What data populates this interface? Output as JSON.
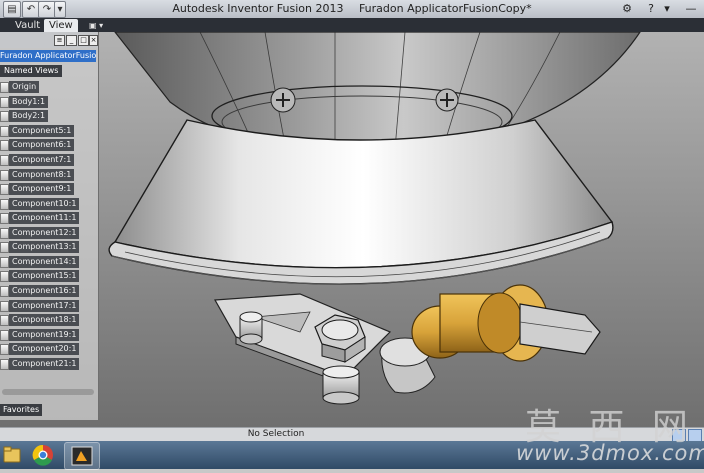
{
  "window": {
    "app_title": "Autodesk Inventor Fusion 2013",
    "document_title": "Furadon ApplicatorFusionCopy*"
  },
  "quick_access": {
    "undo_icon": "undo-icon",
    "redo_icon": "redo-icon",
    "dropdown_icon": "chevron-down-icon"
  },
  "tabs": [
    {
      "label": "Vault",
      "active": false
    },
    {
      "label": "View",
      "active": true
    }
  ],
  "browser": {
    "document_node": "Furadon ApplicatorFusionCopy*",
    "named_views": "Named Views",
    "items": [
      "Origin",
      "Body1:1",
      "Body2:1",
      "Component5:1",
      "Component6:1",
      "Component7:1",
      "Component8:1",
      "Component9:1",
      "Component10:1",
      "Component11:1",
      "Component12:1",
      "Component13:1",
      "Component14:1",
      "Component15:1",
      "Component16:1",
      "Component17:1",
      "Component18:1",
      "Component19:1",
      "Component20:1",
      "Component21:1"
    ],
    "favorites": "Favorites"
  },
  "statusbar": {
    "selection": "No Selection"
  },
  "watermark": {
    "cjk": "莫 西 网",
    "url": "www.3dmox.com"
  },
  "colors": {
    "selection_blue": "#2f6fc8",
    "brass": "#d8a33a"
  }
}
